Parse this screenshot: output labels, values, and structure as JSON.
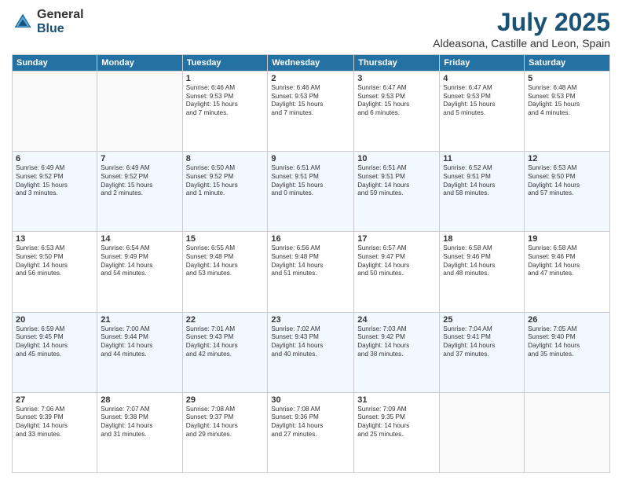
{
  "header": {
    "logo_general": "General",
    "logo_blue": "Blue",
    "month": "July 2025",
    "location": "Aldeasona, Castille and Leon, Spain"
  },
  "weekdays": [
    "Sunday",
    "Monday",
    "Tuesday",
    "Wednesday",
    "Thursday",
    "Friday",
    "Saturday"
  ],
  "weeks": [
    [
      {
        "day": "",
        "info": ""
      },
      {
        "day": "",
        "info": ""
      },
      {
        "day": "1",
        "info": "Sunrise: 6:46 AM\nSunset: 9:53 PM\nDaylight: 15 hours\nand 7 minutes."
      },
      {
        "day": "2",
        "info": "Sunrise: 6:46 AM\nSunset: 9:53 PM\nDaylight: 15 hours\nand 7 minutes."
      },
      {
        "day": "3",
        "info": "Sunrise: 6:47 AM\nSunset: 9:53 PM\nDaylight: 15 hours\nand 6 minutes."
      },
      {
        "day": "4",
        "info": "Sunrise: 6:47 AM\nSunset: 9:53 PM\nDaylight: 15 hours\nand 5 minutes."
      },
      {
        "day": "5",
        "info": "Sunrise: 6:48 AM\nSunset: 9:53 PM\nDaylight: 15 hours\nand 4 minutes."
      }
    ],
    [
      {
        "day": "6",
        "info": "Sunrise: 6:49 AM\nSunset: 9:52 PM\nDaylight: 15 hours\nand 3 minutes."
      },
      {
        "day": "7",
        "info": "Sunrise: 6:49 AM\nSunset: 9:52 PM\nDaylight: 15 hours\nand 2 minutes."
      },
      {
        "day": "8",
        "info": "Sunrise: 6:50 AM\nSunset: 9:52 PM\nDaylight: 15 hours\nand 1 minute."
      },
      {
        "day": "9",
        "info": "Sunrise: 6:51 AM\nSunset: 9:51 PM\nDaylight: 15 hours\nand 0 minutes."
      },
      {
        "day": "10",
        "info": "Sunrise: 6:51 AM\nSunset: 9:51 PM\nDaylight: 14 hours\nand 59 minutes."
      },
      {
        "day": "11",
        "info": "Sunrise: 6:52 AM\nSunset: 9:51 PM\nDaylight: 14 hours\nand 58 minutes."
      },
      {
        "day": "12",
        "info": "Sunrise: 6:53 AM\nSunset: 9:50 PM\nDaylight: 14 hours\nand 57 minutes."
      }
    ],
    [
      {
        "day": "13",
        "info": "Sunrise: 6:53 AM\nSunset: 9:50 PM\nDaylight: 14 hours\nand 56 minutes."
      },
      {
        "day": "14",
        "info": "Sunrise: 6:54 AM\nSunset: 9:49 PM\nDaylight: 14 hours\nand 54 minutes."
      },
      {
        "day": "15",
        "info": "Sunrise: 6:55 AM\nSunset: 9:48 PM\nDaylight: 14 hours\nand 53 minutes."
      },
      {
        "day": "16",
        "info": "Sunrise: 6:56 AM\nSunset: 9:48 PM\nDaylight: 14 hours\nand 51 minutes."
      },
      {
        "day": "17",
        "info": "Sunrise: 6:57 AM\nSunset: 9:47 PM\nDaylight: 14 hours\nand 50 minutes."
      },
      {
        "day": "18",
        "info": "Sunrise: 6:58 AM\nSunset: 9:46 PM\nDaylight: 14 hours\nand 48 minutes."
      },
      {
        "day": "19",
        "info": "Sunrise: 6:58 AM\nSunset: 9:46 PM\nDaylight: 14 hours\nand 47 minutes."
      }
    ],
    [
      {
        "day": "20",
        "info": "Sunrise: 6:59 AM\nSunset: 9:45 PM\nDaylight: 14 hours\nand 45 minutes."
      },
      {
        "day": "21",
        "info": "Sunrise: 7:00 AM\nSunset: 9:44 PM\nDaylight: 14 hours\nand 44 minutes."
      },
      {
        "day": "22",
        "info": "Sunrise: 7:01 AM\nSunset: 9:43 PM\nDaylight: 14 hours\nand 42 minutes."
      },
      {
        "day": "23",
        "info": "Sunrise: 7:02 AM\nSunset: 9:43 PM\nDaylight: 14 hours\nand 40 minutes."
      },
      {
        "day": "24",
        "info": "Sunrise: 7:03 AM\nSunset: 9:42 PM\nDaylight: 14 hours\nand 38 minutes."
      },
      {
        "day": "25",
        "info": "Sunrise: 7:04 AM\nSunset: 9:41 PM\nDaylight: 14 hours\nand 37 minutes."
      },
      {
        "day": "26",
        "info": "Sunrise: 7:05 AM\nSunset: 9:40 PM\nDaylight: 14 hours\nand 35 minutes."
      }
    ],
    [
      {
        "day": "27",
        "info": "Sunrise: 7:06 AM\nSunset: 9:39 PM\nDaylight: 14 hours\nand 33 minutes."
      },
      {
        "day": "28",
        "info": "Sunrise: 7:07 AM\nSunset: 9:38 PM\nDaylight: 14 hours\nand 31 minutes."
      },
      {
        "day": "29",
        "info": "Sunrise: 7:08 AM\nSunset: 9:37 PM\nDaylight: 14 hours\nand 29 minutes."
      },
      {
        "day": "30",
        "info": "Sunrise: 7:08 AM\nSunset: 9:36 PM\nDaylight: 14 hours\nand 27 minutes."
      },
      {
        "day": "31",
        "info": "Sunrise: 7:09 AM\nSunset: 9:35 PM\nDaylight: 14 hours\nand 25 minutes."
      },
      {
        "day": "",
        "info": ""
      },
      {
        "day": "",
        "info": ""
      }
    ]
  ]
}
